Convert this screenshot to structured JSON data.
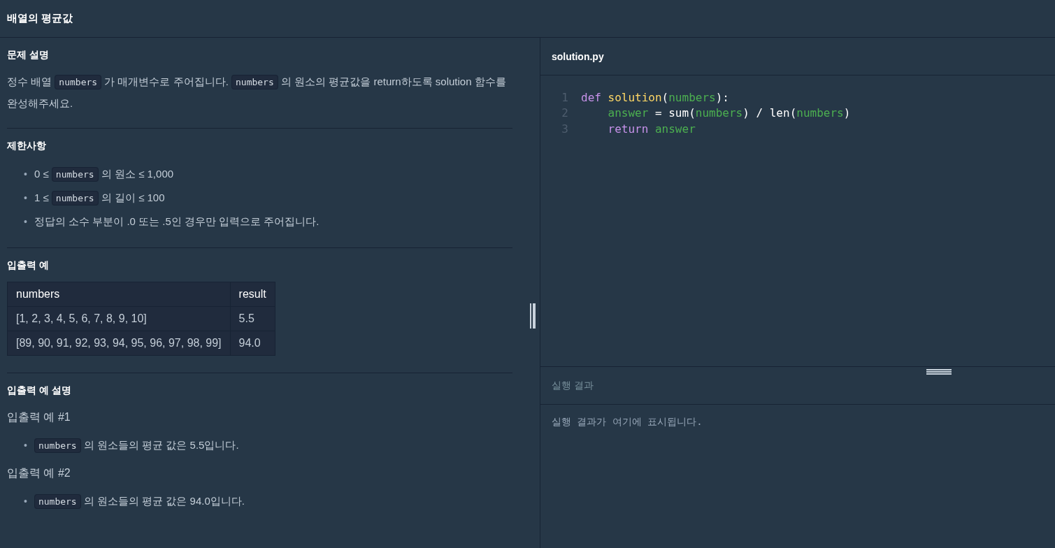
{
  "title": "배열의 평균값",
  "description": {
    "heading": "문제 설명",
    "paragraph": [
      {
        "kind": "text",
        "text": "정수 배열 "
      },
      {
        "kind": "code",
        "text": "numbers"
      },
      {
        "kind": "text",
        "text": " 가 매개변수로 주어집니다. "
      },
      {
        "kind": "code",
        "text": "numbers"
      },
      {
        "kind": "text",
        "text": " 의 원소의 평균값을 return하도록 solution 함수를 완성해주세요."
      }
    ]
  },
  "constraints": {
    "heading": "제한사항",
    "items": [
      {
        "bullet": "•",
        "segments": [
          {
            "kind": "text",
            "text": "0 ≤ "
          },
          {
            "kind": "code",
            "text": "numbers"
          },
          {
            "kind": "text",
            "text": " 의 원소 ≤ 1,000"
          }
        ]
      },
      {
        "bullet": "•",
        "segments": [
          {
            "kind": "text",
            "text": "1 ≤ "
          },
          {
            "kind": "code",
            "text": "numbers"
          },
          {
            "kind": "text",
            "text": " 의 길이 ≤ 100"
          }
        ]
      },
      {
        "bullet": "•",
        "segments": [
          {
            "kind": "text",
            "text": "정답의 소수 부분이 .0 또는 .5인 경우만 입력으로 주어집니다."
          }
        ]
      }
    ]
  },
  "examples": {
    "heading": "입출력 예",
    "columns": [
      "numbers",
      "result"
    ],
    "rows": [
      [
        "[1, 2, 3, 4, 5, 6, 7, 8, 9, 10]",
        "5.5"
      ],
      [
        "[89, 90, 91, 92, 93, 94, 95, 96, 97, 98, 99]",
        "94.0"
      ]
    ]
  },
  "explanation": {
    "heading": "입출력 예 설명",
    "cases": [
      {
        "title": "입출력 예 #1",
        "items": [
          {
            "bullet": "•",
            "segments": [
              {
                "kind": "code",
                "text": "numbers"
              },
              {
                "kind": "text",
                "text": " 의 원소들의 평균 값은 5.5입니다."
              }
            ]
          }
        ]
      },
      {
        "title": "입출력 예 #2",
        "items": [
          {
            "bullet": "•",
            "segments": [
              {
                "kind": "code",
                "text": "numbers"
              },
              {
                "kind": "text",
                "text": " 의 원소들의 평균 값은 94.0입니다."
              }
            ]
          }
        ]
      }
    ]
  },
  "editor": {
    "filename": "solution.py",
    "lines": [
      {
        "number": "1",
        "indented": false,
        "tokens": [
          {
            "kind": "keyword",
            "text": "def "
          },
          {
            "kind": "function",
            "text": "solution"
          },
          {
            "kind": "plain",
            "text": "("
          },
          {
            "kind": "variable",
            "text": "numbers"
          },
          {
            "kind": "plain",
            "text": "):"
          }
        ]
      },
      {
        "number": "2",
        "indented": true,
        "tokens": [
          {
            "kind": "variable",
            "text": "answer"
          },
          {
            "kind": "plain",
            "text": " = sum("
          },
          {
            "kind": "variable",
            "text": "numbers"
          },
          {
            "kind": "plain",
            "text": ") / len("
          },
          {
            "kind": "variable",
            "text": "numbers"
          },
          {
            "kind": "plain",
            "text": ")"
          }
        ]
      },
      {
        "number": "3",
        "indented": true,
        "tokens": [
          {
            "kind": "keyword",
            "text": "return "
          },
          {
            "kind": "variable",
            "text": "answer"
          }
        ]
      }
    ]
  },
  "result": {
    "heading": "실행 결과",
    "message": "실행 결과가 여기에 표시됩니다."
  }
}
